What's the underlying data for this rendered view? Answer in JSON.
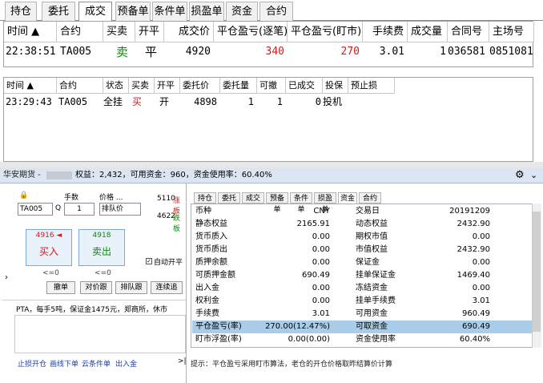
{
  "tabs1": [
    "持仓",
    "委托",
    "成交",
    "预备单",
    "条件单",
    "损盈单",
    "资金",
    "合约"
  ],
  "grid1": {
    "headers": [
      "时间 ▲",
      "合约",
      "买卖",
      "开平",
      "成交价",
      "平仓盈亏(逐笔)",
      "平仓盈亏(盯市)",
      "手续费",
      "成交量",
      "合同号",
      "主场号"
    ],
    "row": [
      "22:38:51",
      "TA005",
      "卖",
      "平",
      "4920",
      "340",
      "270",
      "3.01",
      "1",
      "036581",
      "0851081"
    ]
  },
  "grid2": {
    "headers": [
      "时间 ▲",
      "合约",
      "状态",
      "买卖",
      "开平",
      "委托价",
      "委托量",
      "可撤",
      "已成交",
      "投保",
      "预止损"
    ],
    "row": [
      "23:29:43",
      "TA005",
      "全挂",
      "买",
      "开",
      "4898",
      "1",
      "1",
      "0",
      "投机",
      ""
    ]
  },
  "bar": {
    "broker": "华安期货 - ",
    "text": "权益：2,432，可用资金：960，资金使用率：60.40%"
  },
  "order": {
    "contract": "TA005",
    "qty_label": "手数",
    "qty": "1",
    "price_label": "价格 ...",
    "price_mode": "排队价",
    "ask_price": "5110",
    "ask_label": "涨板",
    "bid_price": "4622",
    "bid_label": "跌板",
    "buy_price": "4916 ◄",
    "buy_label": "买入",
    "sell_price": "4918",
    "sell_label": "卖出",
    "buy_zero": "<=0",
    "sell_zero": "<=0",
    "auto_close": "自动开平",
    "buttons": [
      "撤单",
      "对价跟",
      "排队跟",
      "连续追"
    ],
    "info": "PTA，每手5吨，保证金1475元，郑商所，休市"
  },
  "links": [
    "止损开仓",
    "画线下单",
    "云条件单",
    "出入金"
  ],
  "tabs2": [
    "持仓",
    "委托",
    "成交",
    "预备单",
    "条件单",
    "损盈单",
    "资金",
    "合约"
  ],
  "funds": [
    [
      "币种",
      "CNY",
      "交易日",
      "20191209"
    ],
    [
      "静态权益",
      "2165.91",
      "动态权益",
      "2432.90"
    ],
    [
      "货币质入",
      "0.00",
      "期权市值",
      "0.00"
    ],
    [
      "货币质出",
      "0.00",
      "市值权益",
      "2432.90"
    ],
    [
      "质押余额",
      "0.00",
      "保证金",
      "0.00"
    ],
    [
      "可质押金额",
      "690.49",
      "挂单保证金",
      "1469.40"
    ],
    [
      "出入金",
      "0.00",
      "冻结资金",
      "0.00"
    ],
    [
      "权利金",
      "0.00",
      "挂单手续费",
      "3.01"
    ],
    [
      "手续费",
      "3.01",
      "可用资金",
      "960.49"
    ],
    [
      "平仓盈亏(率)",
      "270.00(12.47%)",
      "可取资金",
      "690.49"
    ],
    [
      "盯市浮盈(率)",
      "0.00(0.00)",
      "资金使用率",
      "60.40%"
    ]
  ],
  "hint": "提示：平仓盈亏采用盯市算法，老仓的开仓价格取昨结算价计算"
}
